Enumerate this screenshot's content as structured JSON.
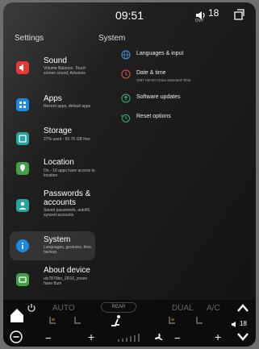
{
  "status": {
    "time": "09:51",
    "volume_value": "18",
    "volume_sub": "DVP"
  },
  "settings": {
    "title": "Settings",
    "items": [
      {
        "title": "Sound",
        "subtitle": "Volume Balance, Touch screen sound, Advance",
        "color": "#e53935"
      },
      {
        "title": "Apps",
        "subtitle": "Recent apps, default apps",
        "color": "#1e88e5"
      },
      {
        "title": "Storage",
        "subtitle": "27% used - 50.76 GB free",
        "color": "#26a69a"
      },
      {
        "title": "Location",
        "subtitle": "On - 10 apps have access to location",
        "color": "#43a047"
      },
      {
        "title": "Passwords & accounts",
        "subtitle": "Saved passwords, autofill, synced accounts",
        "color": "#26a69a"
      },
      {
        "title": "System",
        "subtitle": "Languages, gestures, time, backup",
        "color": "#1e88e5"
      },
      {
        "title": "About device",
        "subtitle": "ulc7870bo_ZR10_zosen hone 8um",
        "color": "#43a047"
      }
    ]
  },
  "system": {
    "title": "System",
    "items": [
      {
        "label": "Languages & input",
        "sub": "",
        "icon": "globe-icon",
        "color": "#4a90d9"
      },
      {
        "label": "Date & time",
        "sub": "GMT+08:00 China Standard Time",
        "icon": "clock-icon",
        "color": "#d9534f"
      },
      {
        "label": "Software updates",
        "sub": "",
        "icon": "update-icon",
        "color": "#3cb371"
      },
      {
        "label": "Reset options",
        "sub": "",
        "icon": "history-icon",
        "color": "#3cb371"
      }
    ]
  },
  "climate": {
    "auto": "AUTO",
    "rear": "REAR",
    "dual": "DUAL",
    "ac": "A/C",
    "minus": "−",
    "plus": "+",
    "volume": "18"
  }
}
